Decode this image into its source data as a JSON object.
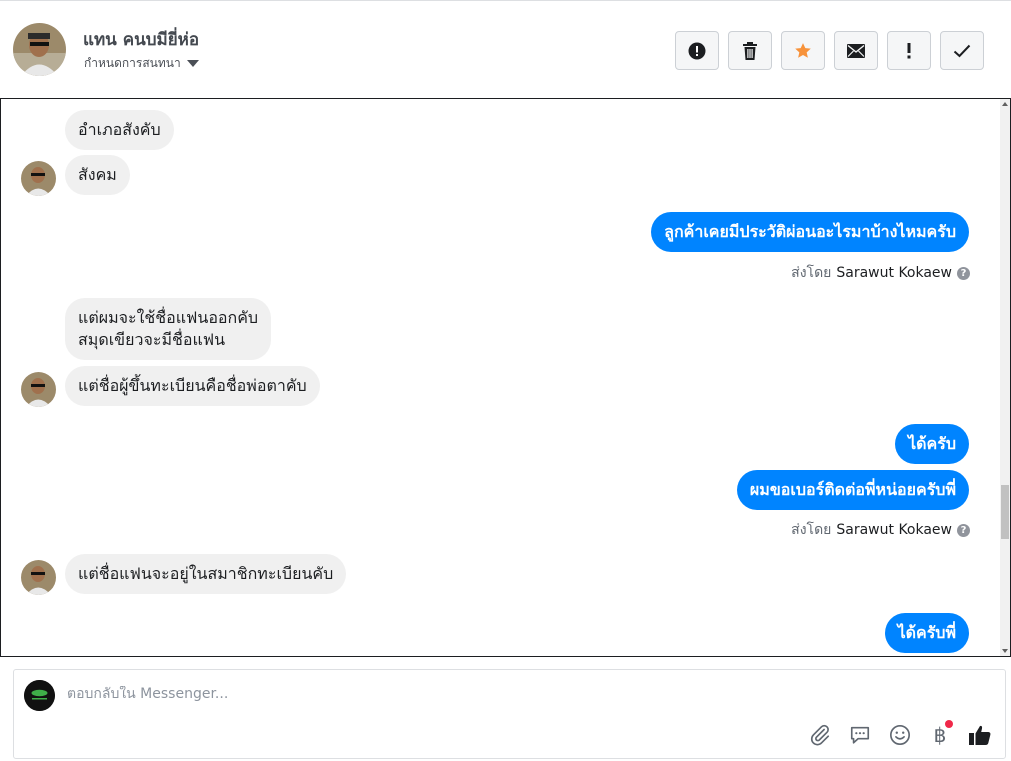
{
  "header": {
    "name": "แทน คนบมียี่ห่อ",
    "subtitle": "กำหนดการสนทนา",
    "toolbar": [
      {
        "name": "report-button",
        "icon": "alert-circle-icon"
      },
      {
        "name": "delete-button",
        "icon": "trash-icon"
      },
      {
        "name": "star-button",
        "icon": "star-icon"
      },
      {
        "name": "mark-unread-button",
        "icon": "envelope-icon"
      },
      {
        "name": "priority-button",
        "icon": "exclamation-icon"
      },
      {
        "name": "done-button",
        "icon": "check-icon"
      }
    ]
  },
  "messages": {
    "m1": "อำเภอสังคับ",
    "m2": "สังคม",
    "m3": "ลูกค้าเคยมีประวัติผ่อนอะไรมาบ้างไหมครับ",
    "m4a": "แต่ผมจะใช้ชื่อแฟนออกคับ",
    "m4b": "สมุดเขียวจะมีชื่อแฟน",
    "m5": "แต่ชื่อผู้ขึ้นทะเบียนคือชื่อพ่อตาคับ",
    "m6": "ได้ครับ",
    "m7": "ผมขอเบอร์ติดต่อพี่หน่อยครับพี่",
    "m8": "แต่ชื่อแฟนจะอยู่ในสมาชิกทะเบียนคับ",
    "m9": "ได้ครับพี่"
  },
  "sent_by": {
    "label": "ส่งโดย",
    "agent": "Sarawut Kokaew",
    "help": "?"
  },
  "composer": {
    "placeholder": "ตอบกลับใน Messenger...",
    "currency_symbol": "฿"
  },
  "colors": {
    "outgoing": "#0084ff",
    "incoming": "#f0f0f0",
    "star": "#f7923a",
    "like": "#1c1e21"
  }
}
